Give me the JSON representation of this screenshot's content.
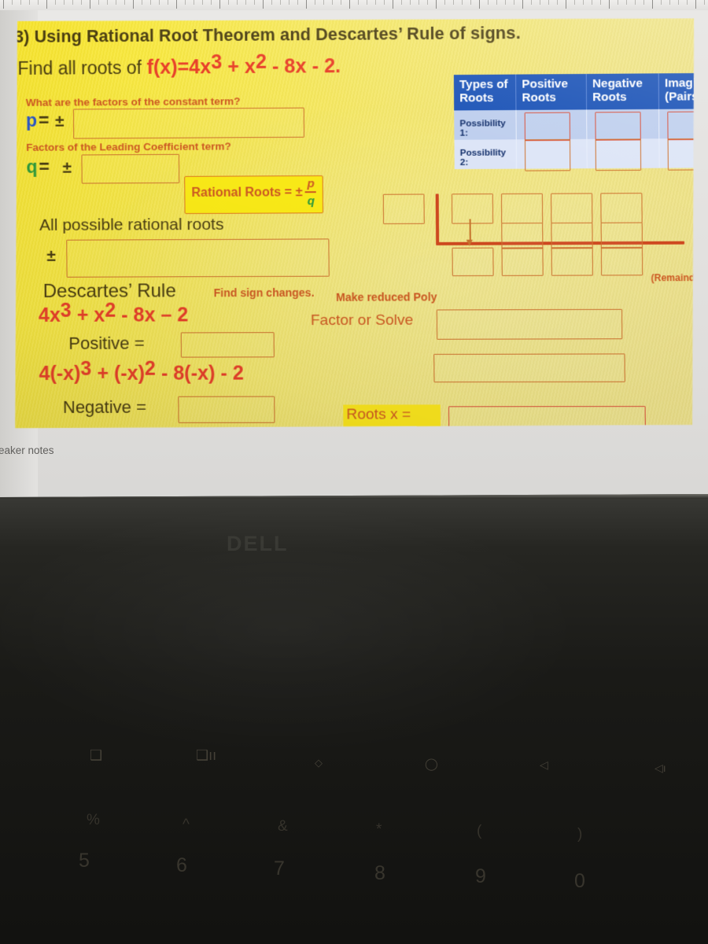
{
  "slide": {
    "title": "3) Using Rational Root Theorem and Descartes’ Rule of signs.",
    "find_prefix": "Find all roots of ",
    "function": {
      "lead": "f(x)=4x",
      "exp1": "3",
      "mid": " + x",
      "exp2": "2",
      "tail": " - 8x - 2."
    },
    "constant_question": "What are the factors of the constant term?",
    "p_label": "p",
    "p_eq": "=",
    "p_pm": "±",
    "leading_question": "Factors of the Leading Coefficient term?",
    "q_label": "q",
    "q_eq": "=",
    "q_pm": "±",
    "rational_roots_chip": {
      "text": "Rational Roots = ±",
      "numerator": "p",
      "denominator": "q"
    },
    "all_possible_label": "All possible rational roots",
    "all_possible_pm": "±",
    "descartes_heading": "Descartes’ Rule",
    "find_sign_changes": "Find sign changes.",
    "poly_positive": {
      "lead": "4x",
      "exp1": "3",
      "mid": " + x",
      "exp2": "2",
      "tail": " - 8x – 2"
    },
    "positive_label": "Positive =",
    "poly_negative": {
      "lead": "4(-x)",
      "exp1": "3",
      "mid": " + (-x)",
      "exp2": "2",
      "tail": " - 8(-x) - 2"
    },
    "negative_label": "Negative =",
    "make_reduced_poly": "Make reduced Poly",
    "factor_or_solve": "Factor or Solve",
    "roots_chip": "Roots x =",
    "remainder_label": "(Remainder)"
  },
  "table": {
    "headers": [
      "Types of\nRoots",
      "Positive\nRoots",
      "Negative\nRoots",
      "Imaginar\n(Pairs)"
    ],
    "header_types_l1": "Types of",
    "header_types_l2": "Roots",
    "header_pos_l1": "Positive",
    "header_pos_l2": "Roots",
    "header_neg_l1": "Negative",
    "header_neg_l2": "Roots",
    "header_img_l1": "Imaginar",
    "header_img_l2": "(Pairs)",
    "rows": [
      {
        "label": "Possibility 1:",
        "positive": "",
        "negative": "",
        "imaginary": ""
      },
      {
        "label": "Possibility 2:",
        "positive": "",
        "negative": "",
        "imaginary": ""
      }
    ]
  },
  "answer_fields": {
    "p_value": "",
    "q_value": "",
    "all_roots_value": "",
    "positive_count": "",
    "negative_count": "",
    "reduced_poly": "",
    "factor_solve": "",
    "roots_value": "",
    "divisor": "",
    "synthetic_row1": [
      "",
      "",
      "",
      ""
    ],
    "synthetic_row2": [
      "",
      "",
      ""
    ],
    "synthetic_row3": [
      "",
      "",
      "",
      ""
    ]
  },
  "notes_bar": {
    "label": "eaker notes"
  },
  "laptop": {
    "brand": "DELL",
    "fn_keys": [
      "❑",
      "❑ıı",
      "◇",
      "◯",
      "◁",
      "◁ı"
    ],
    "number_row_symbols": [
      "%",
      "^",
      "&",
      "*",
      "(",
      ")"
    ],
    "number_row_digits": [
      "5",
      "6",
      "7",
      "8",
      "9",
      "0"
    ]
  },
  "colors": {
    "slide_yellow": "#f5e63a",
    "red_text": "#e8402a",
    "orange_text": "#cf5a23",
    "dark_text": "#4a3d12",
    "blue_p": "#2b55c8",
    "green_q": "#2e9b3c",
    "table_header_blue": "#1f56b8",
    "row1_blue": "#bfcfee",
    "row2_blue": "#dde5f7",
    "box_border": "#cf7330",
    "synthetic_red": "#d0491f",
    "bezel_black": "#1a1a17"
  }
}
